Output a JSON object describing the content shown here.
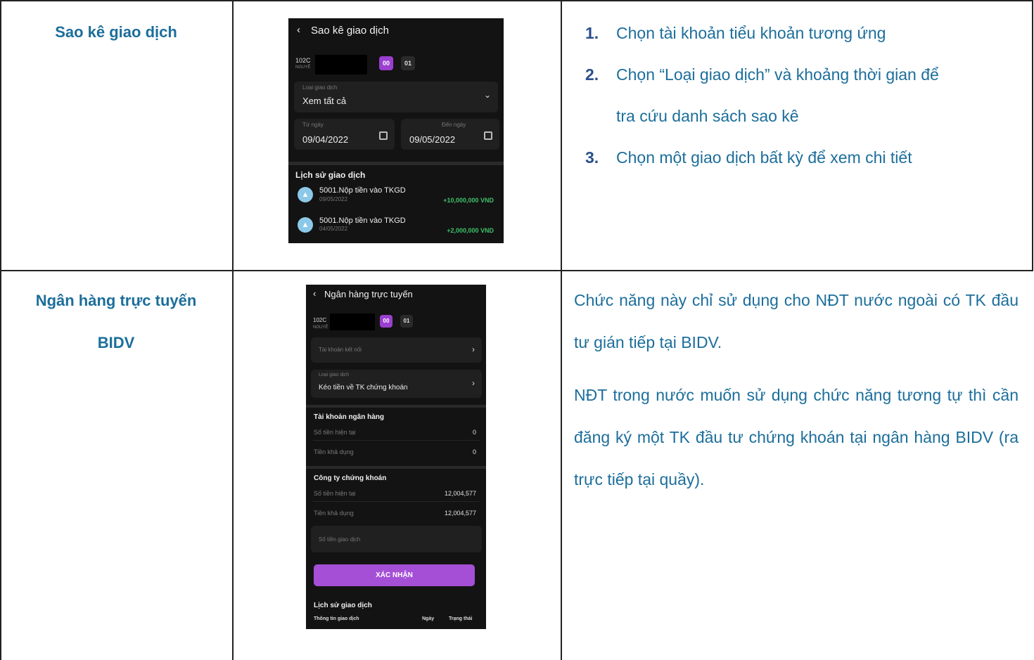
{
  "rows": [
    {
      "title": [
        "Sao kê giao dịch"
      ],
      "steps": [
        {
          "num": "1.",
          "text": "Chọn tài khoản tiểu khoản tương ứng"
        },
        {
          "num": "2.",
          "text": "Chọn “Loại giao dịch” và khoảng thời gian để"
        },
        {
          "num": "",
          "text": "tra cứu danh sách sao kê"
        },
        {
          "num": "3.",
          "text": "Chọn một giao dịch bất kỳ để xem chi tiết"
        }
      ],
      "phone": {
        "title": "Sao kê giao dịch",
        "account_prefix": "102C",
        "account_name": "NGUYỄ",
        "sub_accounts": [
          "00",
          "01"
        ],
        "type_label": "Loại giao dịch",
        "type_value": "Xem tất cả",
        "from_label": "Từ ngày",
        "from_value": "09/04/2022",
        "to_label": "Đến ngày",
        "to_value": "09/05/2022",
        "history_title": "Lịch sử giao dịch",
        "transactions": [
          {
            "name": "5001.Nộp tiền vào TKGD",
            "date": "09/05/2022",
            "amount": "+10,000,000 VND"
          },
          {
            "name": "5001.Nộp tiền vào TKGD",
            "date": "04/05/2022",
            "amount": "+2,000,000 VND"
          }
        ]
      }
    },
    {
      "title": [
        "Ngân hàng trực tuyến",
        "BIDV"
      ],
      "paragraphs": [
        "Chức năng này chỉ sử dụng cho NĐT nước ngoài có TK đầu tư gián tiếp tại BIDV.",
        "NĐT trong nước muốn sử dụng chức năng tương tự thì cần đăng ký một TK đầu tư chứng khoán tại ngân hàng BIDV (ra trực tiếp tại quầy)."
      ],
      "phone": {
        "title": "Ngân hàng trực tuyến",
        "account_prefix": "102C",
        "account_name": "NGUYỄ",
        "sub_accounts": [
          "00",
          "01"
        ],
        "linked_account_label": "Tài khoản kết nối",
        "type_label": "Loại giao dịch",
        "type_value": "Kéo tiền về TK chứng khoán",
        "bank_section": "Tài khoản ngân hàng",
        "bank_rows": [
          {
            "label": "Số tiền hiện tại",
            "value": "0"
          },
          {
            "label": "Tiền khả dụng",
            "value": "0"
          }
        ],
        "company_section": "Công ty chứng khoán",
        "company_rows": [
          {
            "label": "Số tiền hiện tại",
            "value": "12,004,577"
          },
          {
            "label": "Tiền khả dụng",
            "value": "12,004,577"
          }
        ],
        "amount_placeholder": "Số tiền giao dịch",
        "confirm_label": "XÁC NHẬN",
        "history_title": "Lịch sử giao dịch",
        "history_columns": [
          "Thông tin giao dịch",
          "Ngày",
          "Trạng thái"
        ]
      }
    }
  ]
}
